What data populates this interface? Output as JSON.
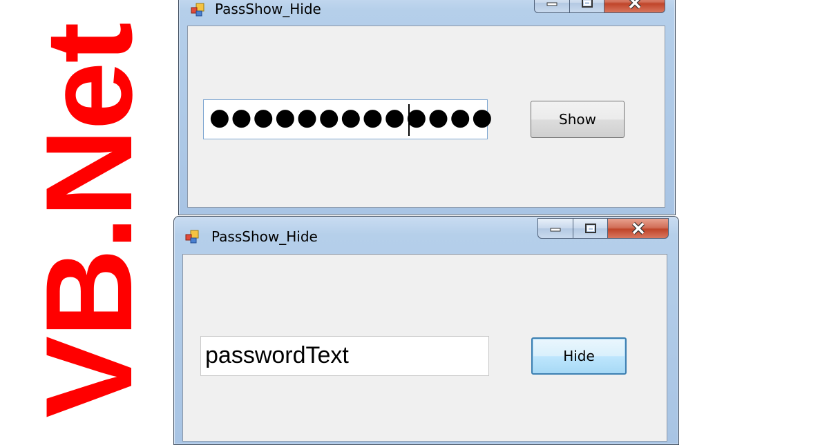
{
  "banner": {
    "text": "VB.Net",
    "color": "#ff0000"
  },
  "windows": [
    {
      "title": "PassShow_Hide",
      "password_masked": "●●●●●●●●●●●●●",
      "button_label": "Show"
    },
    {
      "title": "PassShow_Hide",
      "password_plain": "passwordText",
      "button_label": "Hide"
    }
  ],
  "icons": {
    "app": "app-window-icon",
    "minimize": "minimize-icon",
    "maximize": "maximize-icon",
    "close": "close-icon"
  }
}
